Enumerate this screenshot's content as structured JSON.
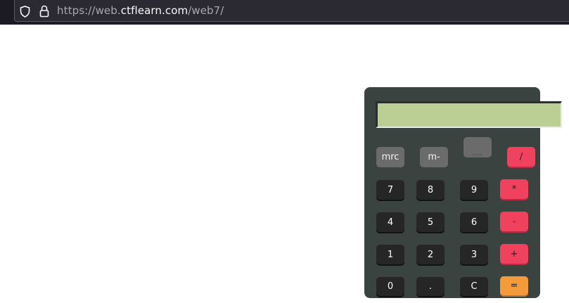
{
  "browser": {
    "url_prefix": "https://web.",
    "url_domain": "ctflearn.com",
    "url_path": "/web7/",
    "icons": [
      "shield-icon",
      "lock-icon"
    ]
  },
  "calculator": {
    "display_value": "",
    "keys": {
      "mrc": "mrc",
      "m_minus": "m-",
      "m_plus": "m+",
      "divide": "/",
      "seven": "7",
      "eight": "8",
      "nine": "9",
      "multiply": "*",
      "four": "4",
      "five": "5",
      "six": "6",
      "minus": "-",
      "one": "1",
      "two": "2",
      "three": "3",
      "plus": "+",
      "zero": "0",
      "dot": ".",
      "clear": "C",
      "equals": "="
    },
    "colors": {
      "body": "#3a4340",
      "display": "#bbcf94",
      "operator": "#f0425f",
      "equals": "#f39a3a",
      "digit": "#262626",
      "memory": "#6b6b6b"
    }
  }
}
